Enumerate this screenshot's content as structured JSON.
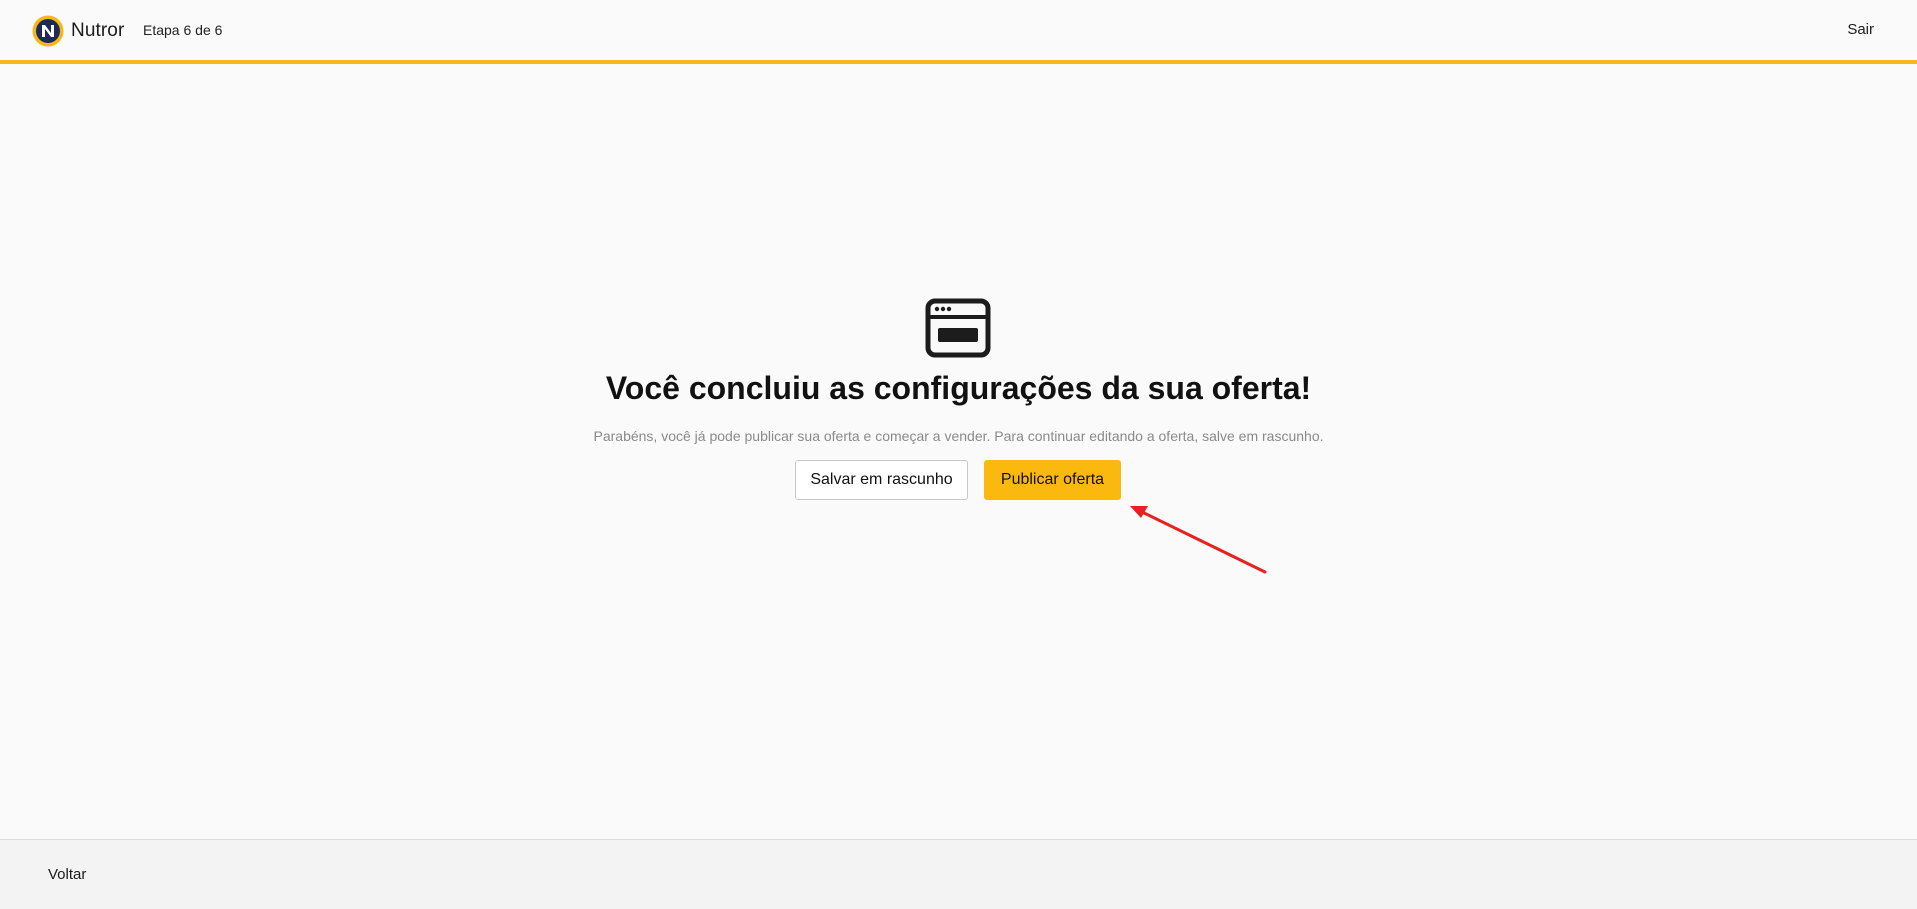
{
  "header": {
    "brand_name": "Nutror",
    "step_label": "Etapa 6 de 6",
    "exit_label": "Sair",
    "accent_color": "#f5b819",
    "logo_icon": "nutror-logo-icon"
  },
  "main": {
    "icon": "browser-window-icon",
    "title": "Você concluiu as configurações da sua oferta!",
    "subtitle": "Parabéns, você já pode publicar sua oferta e começar a vender. Para continuar editando a oferta, salve em rascunho.",
    "draft_button_label": "Salvar em rascunho",
    "publish_button_label": "Publicar oferta",
    "publish_button_color": "#fbb90f",
    "annotation_arrow_color": "#e8201f"
  },
  "footer": {
    "back_label": "Voltar"
  }
}
